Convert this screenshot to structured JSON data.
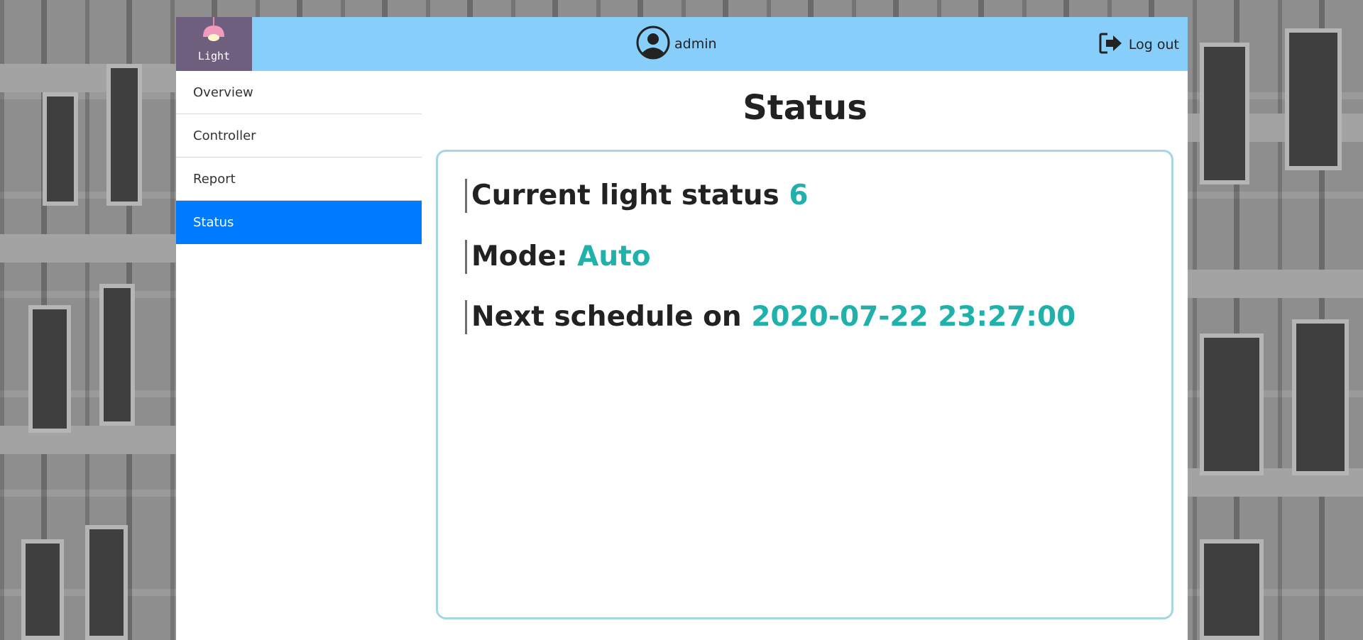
{
  "app": {
    "logo_text": "Light",
    "user": {
      "name": "admin"
    },
    "logout_label": "Log out"
  },
  "sidebar": {
    "items": [
      {
        "label": "Overview",
        "active": false
      },
      {
        "label": "Controller",
        "active": false
      },
      {
        "label": "Report",
        "active": false
      },
      {
        "label": "Status",
        "active": true
      }
    ]
  },
  "main": {
    "title": "Status",
    "status": {
      "light_label": "Current light status",
      "light_value": "6",
      "mode_label": "Mode:",
      "mode_value": "Auto",
      "schedule_label": "Next schedule on",
      "schedule_value": "2020-07-22 23:27:00"
    }
  },
  "colors": {
    "topbar": "#87cefa",
    "logo_bg": "#6d5f7d",
    "active_nav": "#007bff",
    "value_accent": "#20b2aa",
    "card_border": "#a7d5e2"
  },
  "icons": {
    "logo": "ceiling-lamp-icon",
    "user": "user-circle-icon",
    "logout": "sign-out-icon"
  }
}
